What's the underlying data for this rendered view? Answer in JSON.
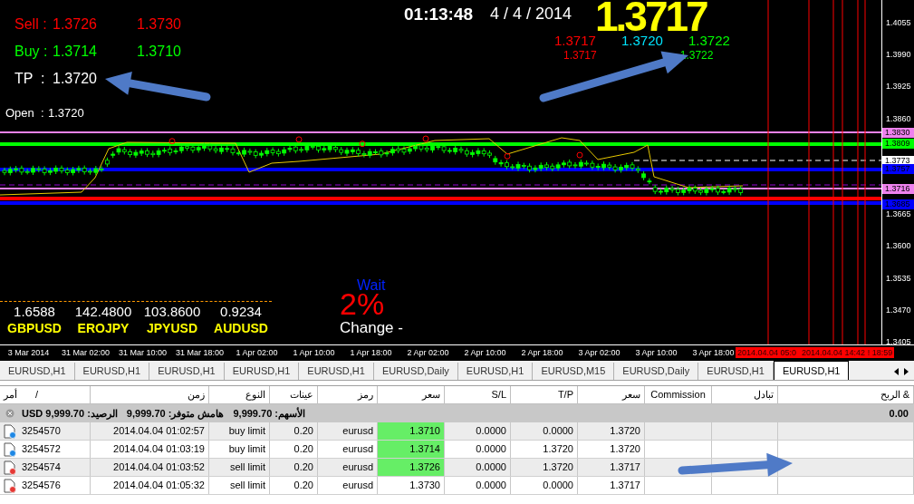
{
  "quotes": {
    "rows": [
      {
        "kind": "sell",
        "label": "Sell :",
        "value": "1.3726",
        "value_2": "1.3730"
      },
      {
        "kind": "buy",
        "label": "Buy :",
        "value": "1.3714",
        "value_2": "1.3710"
      }
    ],
    "tp": {
      "label": "TP  :",
      "value": "1.3720"
    },
    "open": {
      "label": "Open  :",
      "value": "1.3720"
    }
  },
  "clock": "01:13:48",
  "date": "4 / 4 / 2014",
  "price": "1.3717",
  "levels": {
    "row_1": [
      {
        "text": "1.3717",
        "color": "#ff0000"
      },
      {
        "text": "1.3720",
        "color": "#00e5ff"
      },
      {
        "text": "1.3722",
        "color": "#00ff00"
      }
    ],
    "row_2": [
      {
        "text": "1.3717",
        "color": "#ff0000"
      },
      {
        "text": "1.3722",
        "color": "#00ff00"
      }
    ]
  },
  "currencies": [
    {
      "value": "1.6588",
      "symbol": "GBPUSD"
    },
    {
      "value": "142.4800",
      "symbol": "EROJPY"
    },
    {
      "value": "103.8600",
      "symbol": "JPYUSD"
    },
    {
      "value": "0.9234",
      "symbol": "AUDUSD"
    }
  ],
  "signal": {
    "status": "Wait",
    "percent": "2%",
    "change": "Change -"
  },
  "price_axis": {
    "ticks": [
      "1.4055",
      "1.3990",
      "1.3925",
      "1.3860",
      "1.3665",
      "1.3600",
      "1.3535",
      "1.3470",
      "1.3405"
    ],
    "tags": [
      {
        "text": "1.3830",
        "color": "#ee82ee"
      },
      {
        "text": "1.3809",
        "color": "#00ff00"
      },
      {
        "text": "1.3773",
        "color": "#ffffff"
      },
      {
        "text": "1.3757",
        "color": "#0000ff"
      },
      {
        "text": "1.3716",
        "color": "#ee82ee"
      },
      {
        "text": "1.3685",
        "color": "#0000ff"
      }
    ]
  },
  "time_axis": {
    "labels": [
      "3 Mar 2014",
      "31 Mar 02:00",
      "31 Mar 10:00",
      "31 Mar 18:00",
      "1 Apr 02:00",
      "1 Apr 10:00",
      "1 Apr 18:00",
      "2 Apr 02:00",
      "2 Apr 10:00",
      "2 Apr 18:00",
      "3 Apr 02:00",
      "3 Apr 10:00",
      "3 Apr 18:00"
    ],
    "markers": [
      "2014.04.04 05:0",
      "2014.04.04 14:42 ! 18:59"
    ]
  },
  "tabs": [
    {
      "label": "EURUSD,H1",
      "selected": false
    },
    {
      "label": "EURUSD,H1",
      "selected": false
    },
    {
      "label": "EURUSD,H1",
      "selected": false
    },
    {
      "label": "EURUSD,H1",
      "selected": false
    },
    {
      "label": "EURUSD,H1",
      "selected": false
    },
    {
      "label": "EURUSD,Daily",
      "selected": false
    },
    {
      "label": "EURUSD,H1",
      "selected": false
    },
    {
      "label": "EURUSD,M15",
      "selected": false
    },
    {
      "label": "EURUSD,Daily",
      "selected": false
    },
    {
      "label": "EURUSD,H1",
      "selected": false
    },
    {
      "label": "EURUSD,H1",
      "selected": true
    }
  ],
  "table": {
    "sort_mark": "/",
    "columns": [
      "الربح &",
      "تبادل",
      "Commission",
      "سعر",
      "T/P",
      "S/L",
      "سعر",
      "رمز",
      "عينات",
      "النوع",
      "زمن",
      "أمر"
    ],
    "balance": {
      "items": [
        "الأسهم: 9,999.70",
        "هامش متوفر: 9,999.70",
        "الرصيد: USD 9,999.70"
      ],
      "total": "0.00"
    },
    "rows": [
      {
        "kind": "buy",
        "order": "3254570",
        "time": "2014.04.04 01:02:57",
        "type": "buy limit",
        "volume": "0.20",
        "symbol": "eurusd",
        "price": "1.3710",
        "highlighted": true,
        "sl": "0.0000",
        "tp": "0.0000",
        "current": "1.3720"
      },
      {
        "kind": "buy",
        "order": "3254572",
        "time": "2014.04.04 01:03:19",
        "type": "buy limit",
        "volume": "0.20",
        "symbol": "eurusd",
        "price": "1.3714",
        "highlighted": true,
        "sl": "0.0000",
        "tp": "1.3720",
        "current": "1.3720"
      },
      {
        "kind": "sell",
        "order": "3254574",
        "time": "2014.04.04 01:03:52",
        "type": "sell limit",
        "volume": "0.20",
        "symbol": "eurusd",
        "price": "1.3726",
        "highlighted": true,
        "sl": "0.0000",
        "tp": "1.3720",
        "current": "1.3717"
      },
      {
        "kind": "sell",
        "order": "3254576",
        "time": "2014.04.04 01:05:32",
        "type": "sell limit",
        "volume": "0.20",
        "symbol": "eurusd",
        "price": "1.3730",
        "highlighted": false,
        "sl": "0.0000",
        "tp": "0.0000",
        "current": "1.3717"
      }
    ]
  }
}
